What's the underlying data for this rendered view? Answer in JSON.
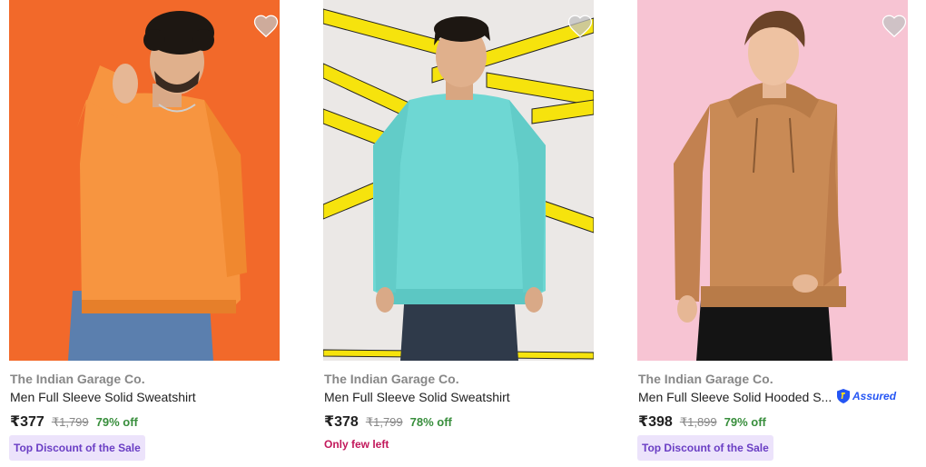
{
  "colors": {
    "brand_text": "#878787",
    "discount_green": "#388e3c",
    "tag_bg": "#ece3fb",
    "tag_text": "#6a3ec4",
    "low_stock": "#c2185b",
    "assured_blue": "#2455f4"
  },
  "products": [
    {
      "brand": "The Indian Garage Co.",
      "title": "Men Full Sleeve Solid Sweatshirt",
      "price": "₹377",
      "mrp": "₹1,799",
      "discount": "79% off",
      "tag": "Top Discount of the Sale",
      "image_icon": "orange-sweatshirt-photo"
    },
    {
      "brand": "The Indian Garage Co.",
      "title": "Men Full Sleeve Solid Sweatshirt",
      "price": "₹378",
      "mrp": "₹1,799",
      "discount": "78% off",
      "stock_note": "Only few left",
      "image_icon": "teal-sweatshirt-photo"
    },
    {
      "brand": "The Indian Garage Co.",
      "title": "Men Full Sleeve Solid Hooded S...",
      "price": "₹398",
      "mrp": "₹1,899",
      "discount": "79% off",
      "tag": "Top Discount of the Sale",
      "assured_label": "Assured",
      "image_icon": "tan-hoodie-photo"
    }
  ]
}
